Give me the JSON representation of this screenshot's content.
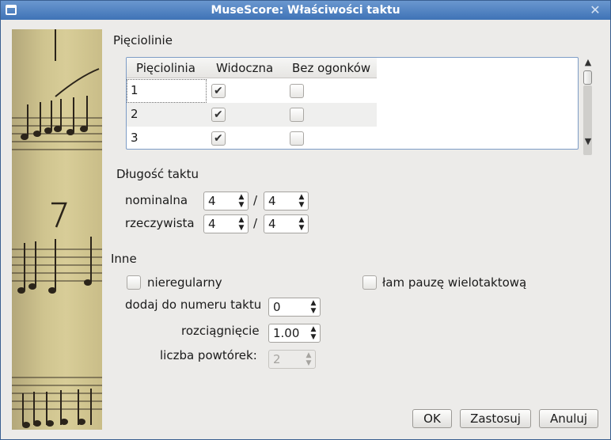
{
  "window": {
    "title": "MuseScore: Właściwości taktu"
  },
  "staves": {
    "section_title": "Pięciolinie",
    "columns": [
      "Pięciolinia",
      "Widoczna",
      "Bez ogonków"
    ],
    "rows": [
      {
        "num": "1",
        "visible": true,
        "stemless": false
      },
      {
        "num": "2",
        "visible": true,
        "stemless": false
      },
      {
        "num": "3",
        "visible": true,
        "stemless": false
      }
    ]
  },
  "length": {
    "section_title": "Długość taktu",
    "nominal_label": "nominalna",
    "nominal_num": "4",
    "nominal_den": "4",
    "actual_label": "rzeczywista",
    "actual_num": "4",
    "actual_den": "4",
    "separator": "/"
  },
  "other": {
    "section_title": "Inne",
    "irregular_label": "nieregularny",
    "break_mmrest_label": "łam pauzę wielotaktową",
    "add_to_number_label": "dodaj do numeru taktu",
    "add_to_number_value": "0",
    "stretch_label": "rozciągnięcie",
    "stretch_value": "1.00",
    "repeat_label": "liczba powtórek:",
    "repeat_value": "2"
  },
  "buttons": {
    "ok": "OK",
    "apply": "Zastosuj",
    "cancel": "Anuluj"
  },
  "icons": {
    "check": "✔",
    "spin_up": "▲",
    "spin_down": "▼",
    "close": "✕"
  }
}
